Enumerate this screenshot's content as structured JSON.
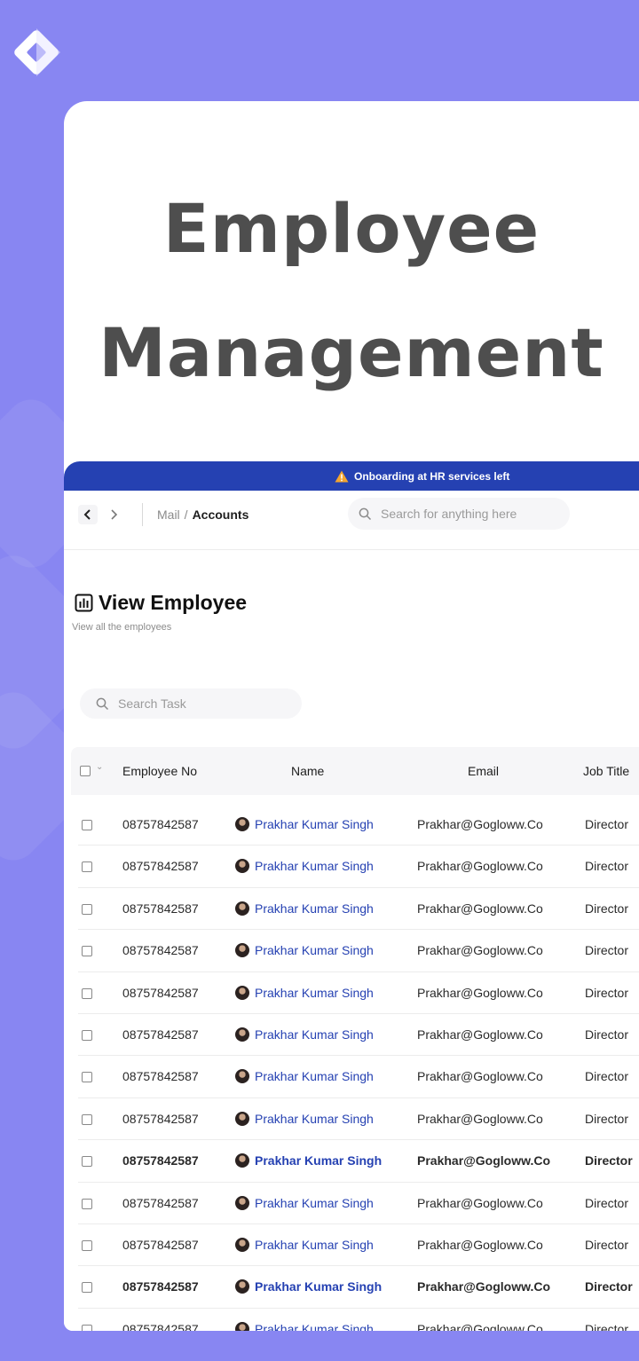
{
  "headline": {
    "line1": "Employee",
    "line2": "Management"
  },
  "banner": {
    "text": "Onboarding at HR services left",
    "icon": "warning-icon"
  },
  "topbar": {
    "back_icon": "chevron-left-icon",
    "forward_icon": "chevron-right-icon",
    "breadcrumb": [
      "Mail",
      "/",
      "Accounts"
    ],
    "search_placeholder": "Search for anything here"
  },
  "page": {
    "title": "View Employee",
    "title_icon": "chart-icon",
    "subtitle": "View all the employees",
    "search_placeholder": "Search Task"
  },
  "table": {
    "columns": [
      "Employee No",
      "Name",
      "Email",
      "Job Title"
    ],
    "rows": [
      {
        "no": "08757842587",
        "name": "Prakhar Kumar Singh",
        "email": "Prakhar@Gogloww.Co",
        "job": "Director"
      },
      {
        "no": "08757842587",
        "name": "Prakhar Kumar Singh",
        "email": "Prakhar@Gogloww.Co",
        "job": "Director"
      },
      {
        "no": "08757842587",
        "name": "Prakhar Kumar Singh",
        "email": "Prakhar@Gogloww.Co",
        "job": "Director"
      },
      {
        "no": "08757842587",
        "name": "Prakhar Kumar Singh",
        "email": "Prakhar@Gogloww.Co",
        "job": "Director"
      },
      {
        "no": "08757842587",
        "name": "Prakhar Kumar Singh",
        "email": "Prakhar@Gogloww.Co",
        "job": "Director"
      },
      {
        "no": "08757842587",
        "name": "Prakhar Kumar Singh",
        "email": "Prakhar@Gogloww.Co",
        "job": "Director"
      },
      {
        "no": "08757842587",
        "name": "Prakhar Kumar Singh",
        "email": "Prakhar@Gogloww.Co",
        "job": "Director"
      },
      {
        "no": "08757842587",
        "name": "Prakhar Kumar Singh",
        "email": "Prakhar@Gogloww.Co",
        "job": "Director"
      },
      {
        "no": "08757842587",
        "name": "Prakhar Kumar Singh",
        "email": "Prakhar@Gogloww.Co",
        "job": "Director"
      },
      {
        "no": "08757842587",
        "name": "Prakhar Kumar Singh",
        "email": "Prakhar@Gogloww.Co",
        "job": "Director"
      },
      {
        "no": "08757842587",
        "name": "Prakhar Kumar Singh",
        "email": "Prakhar@Gogloww.Co",
        "job": "Director"
      },
      {
        "no": "08757842587",
        "name": "Prakhar Kumar Singh",
        "email": "Prakhar@Gogloww.Co",
        "job": "Director"
      },
      {
        "no": "08757842587",
        "name": "Prakhar Kumar Singh",
        "email": "Prakhar@Gogloww.Co",
        "job": "Director"
      }
    ]
  },
  "colors": {
    "background": "#8886f2",
    "banner": "#2541b2",
    "name_link": "#2541b2",
    "headline": "#4e4e4e"
  }
}
